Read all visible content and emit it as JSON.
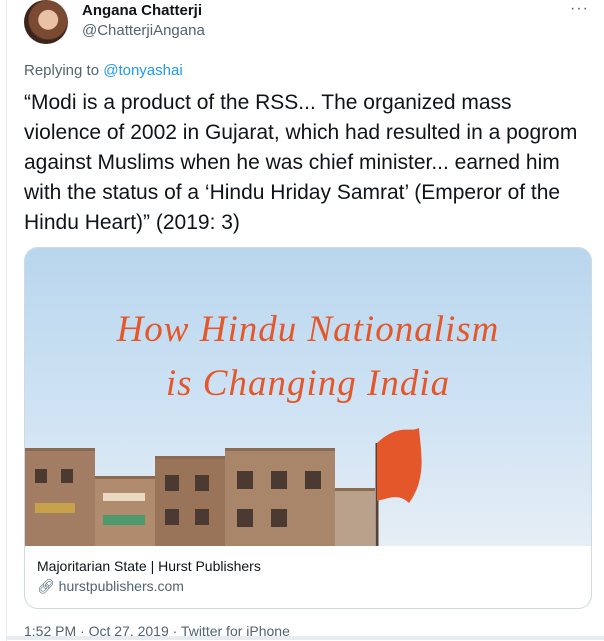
{
  "author": {
    "name": "Angana Chatterji",
    "handle": "@ChatterjiAngana",
    "more_icon": "ellipsis-icon"
  },
  "reply": {
    "prefix": "Replying to ",
    "handle": "@tonyashai"
  },
  "tweet": {
    "text": "“Modi is a product of the RSS... The organized mass violence of 2002 in Gujarat, which had resulted in a pogrom against Muslims when he was chief minister... earned him with the status of a ‘Hindu Hriday Samrat’ (Emperor of the Hindu Heart)” (2019: 3)"
  },
  "card": {
    "image_title_line1": "How Hindu Nationalism",
    "image_title_line2": "is Changing India",
    "title": "Majoritarian State | Hurst Publishers",
    "link_icon": "link-icon",
    "url": "hurstpublishers.com"
  },
  "footer": {
    "meta": "1:52 PM · Oct 27, 2019 · Twitter for iPhone"
  },
  "colors": {
    "link": "#1d9bf0",
    "muted": "#536471",
    "flag": "#e4572a",
    "sky": "#b9d6ee"
  }
}
